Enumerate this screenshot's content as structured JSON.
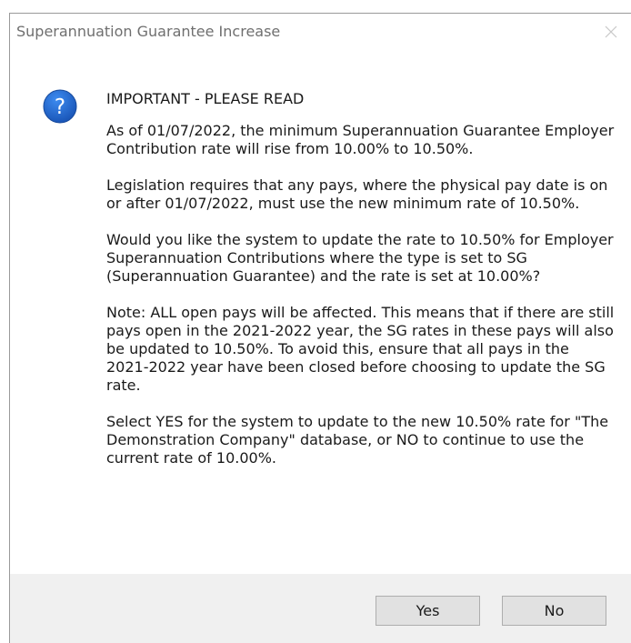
{
  "dialog": {
    "title": "Superannuation Guarantee Increase",
    "icon": "question-icon",
    "heading": "IMPORTANT - PLEASE READ",
    "paragraphs": [
      "As of 01/07/2022, the minimum Superannuation Guarantee Employer Contribution rate will rise from 10.00% to 10.50%.",
      "Legislation requires that any pays, where the physical pay date is on or after 01/07/2022, must use the new minimum rate of 10.50%.",
      "Would you like the system to update the rate to 10.50% for Employer Superannuation Contributions where the type is set to SG (Superannuation Guarantee) and the rate is set at 10.00%?",
      "Note: ALL open pays will be affected. This means that if there are still pays open in the 2021-2022 year, the SG rates in these pays will also be updated to 10.50%. To avoid this, ensure that all pays in the 2021-2022 year have been closed before choosing to update the SG rate.",
      "Select YES for the system to update to the new 10.50% rate for \"The Demonstration Company\" database, or NO to continue to use the current rate of 10.00%."
    ],
    "buttons": {
      "yes_label": "Yes",
      "no_label": "No"
    }
  },
  "colors": {
    "icon_blue": "#1c64c8",
    "footer_bg": "#f0f0f0",
    "title_text": "#6f6f6f"
  }
}
